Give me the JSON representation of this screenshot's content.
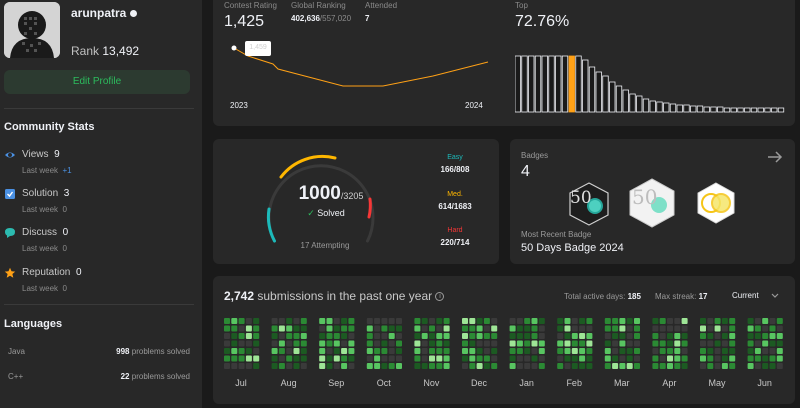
{
  "profile": {
    "username": "arunpatra",
    "rank_label": "Rank",
    "rank_value": "13,492",
    "edit_profile_label": "Edit Profile"
  },
  "community": {
    "title": "Community Stats",
    "items": [
      {
        "label": "Views",
        "value": "9",
        "sub_label": "Last week",
        "sub_value": "+1",
        "icon": "eye-icon",
        "color": "#4a90e2"
      },
      {
        "label": "Solution",
        "value": "3",
        "sub_label": "Last week",
        "sub_value": "0",
        "icon": "solution-icon",
        "color": "#4a90e2"
      },
      {
        "label": "Discuss",
        "value": "0",
        "sub_label": "Last week",
        "sub_value": "0",
        "icon": "discuss-icon",
        "color": "#2cbbb0"
      },
      {
        "label": "Reputation",
        "value": "0",
        "sub_label": "Last week",
        "sub_value": "0",
        "icon": "star-icon",
        "color": "#ffa116"
      }
    ]
  },
  "languages": {
    "title": "Languages",
    "items": [
      {
        "name": "Java",
        "count": "998",
        "suffix": "problems solved"
      },
      {
        "name": "C++",
        "count": "22",
        "suffix": "problems solved"
      }
    ]
  },
  "contest": {
    "rating_label": "Contest Rating",
    "rating_value": "1,425",
    "global_label": "Global Ranking",
    "global_value": "402,636",
    "global_total": "/557,020",
    "attended_label": "Attended",
    "attended_value": "7",
    "tooltip": "1,459",
    "year_start": "2023",
    "year_end": "2024",
    "top_label": "Top",
    "top_value": "72.76%",
    "line_color": "#ffa116"
  },
  "solved": {
    "solved_count": "1000",
    "total": "/3205",
    "solved_label": "Solved",
    "attempting": "17 Attempting",
    "easy_label": "Easy",
    "easy_value": "166/808",
    "medium_label": "Med.",
    "medium_value": "614/1683",
    "hard_label": "Hard",
    "hard_value": "220/714",
    "easy_color": "#1cbaba",
    "medium_color": "#ffb700",
    "hard_color": "#f63737",
    "easy_fraction": 0.2054,
    "medium_fraction": 0.3648,
    "hard_fraction": 0.3081
  },
  "badges": {
    "title": "Badges",
    "count": "4",
    "recent_label": "Most Recent Badge",
    "recent_name": "50 Days Badge 2024",
    "badge_a_number": "50",
    "badge_b_number": "50"
  },
  "submissions": {
    "count": "2,742",
    "text": "submissions in the past one year",
    "active_label": "Total active days:",
    "active_value": "185",
    "streak_label": "Max streak:",
    "streak_value": "17",
    "period": "Current",
    "months": [
      "Jul",
      "Aug",
      "Sep",
      "Oct",
      "Nov",
      "Dec",
      "Jan",
      "Feb",
      "Mar",
      "Apr",
      "May",
      "Jun"
    ]
  }
}
